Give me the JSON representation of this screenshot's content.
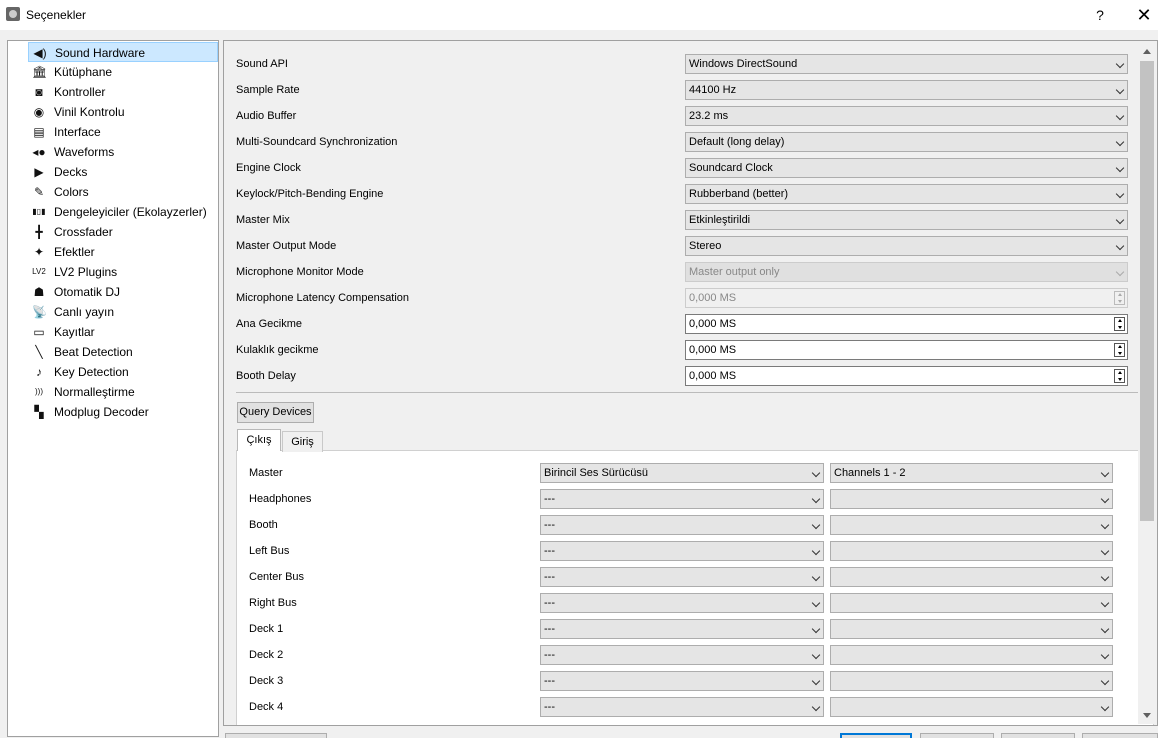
{
  "window": {
    "title": "Seçenekler",
    "help": "?",
    "close": "✕"
  },
  "sidebar": {
    "items": [
      {
        "label": "Sound Hardware",
        "icon": "speaker-icon",
        "glyph": "◀)",
        "selected": true
      },
      {
        "label": "Kütüphane",
        "icon": "library-icon",
        "glyph": "🏛"
      },
      {
        "label": "Kontroller",
        "icon": "controller-icon",
        "glyph": "◙"
      },
      {
        "label": "Vinil Kontrolu",
        "icon": "vinyl-icon",
        "glyph": "◉"
      },
      {
        "label": "Interface",
        "icon": "interface-icon",
        "glyph": "▤"
      },
      {
        "label": "Waveforms",
        "icon": "waveforms-icon",
        "glyph": "◂●"
      },
      {
        "label": "Decks",
        "icon": "play-icon",
        "glyph": "▶"
      },
      {
        "label": "Colors",
        "icon": "paint-icon",
        "glyph": "✎"
      },
      {
        "label": "Dengeleyiciler (Ekolayzerler)",
        "icon": "equalizer-icon",
        "glyph": "▮▯▮"
      },
      {
        "label": "Crossfader",
        "icon": "crossfader-icon",
        "glyph": "╋"
      },
      {
        "label": "Efektler",
        "icon": "effects-icon",
        "glyph": "✦"
      },
      {
        "label": "LV2 Plugins",
        "icon": "lv2-icon",
        "glyph": "LV2"
      },
      {
        "label": "Otomatik DJ",
        "icon": "robot-icon",
        "glyph": "☗"
      },
      {
        "label": "Canlı yayın",
        "icon": "broadcast-icon",
        "glyph": "📡"
      },
      {
        "label": "Kayıtlar",
        "icon": "recording-icon",
        "glyph": "▭"
      },
      {
        "label": "Beat Detection",
        "icon": "beat-icon",
        "glyph": "╲"
      },
      {
        "label": "Key Detection",
        "icon": "key-icon",
        "glyph": "♪"
      },
      {
        "label": "Normalleştirme",
        "icon": "normalize-icon",
        "glyph": ")))"
      },
      {
        "label": "Modplug Decoder",
        "icon": "modplug-icon",
        "glyph": "▚"
      }
    ]
  },
  "settings": [
    {
      "label": "Sound API",
      "value": "Windows DirectSound",
      "kind": "combo"
    },
    {
      "label": "Sample Rate",
      "value": "44100 Hz",
      "kind": "combo"
    },
    {
      "label": "Audio Buffer",
      "value": "23.2 ms",
      "kind": "combo"
    },
    {
      "label": "Multi-Soundcard Synchronization",
      "value": "Default (long delay)",
      "kind": "combo"
    },
    {
      "label": "Engine Clock",
      "value": "Soundcard Clock",
      "kind": "combo"
    },
    {
      "label": "Keylock/Pitch-Bending Engine",
      "value": "Rubberband (better)",
      "kind": "combo"
    },
    {
      "label": "Master Mix",
      "value": "Etkinleştirildi",
      "kind": "combo"
    },
    {
      "label": "Master Output Mode",
      "value": "Stereo",
      "kind": "combo"
    },
    {
      "label": "Microphone Monitor Mode",
      "value": "Master output only",
      "kind": "combo",
      "disabled": true
    },
    {
      "label": "Microphone Latency Compensation",
      "value": "0,000 MS",
      "kind": "spin",
      "disabled": true
    },
    {
      "label": "Ana Gecikme",
      "value": "0,000 MS",
      "kind": "spin"
    },
    {
      "label": "Kulaklık gecikme",
      "value": "0,000 MS",
      "kind": "spin"
    },
    {
      "label": "Booth Delay",
      "value": "0,000 MS",
      "kind": "spin"
    }
  ],
  "query_button": "Query Devices",
  "tabs": [
    {
      "label": "Çıkış",
      "active": true
    },
    {
      "label": "Giriş",
      "active": false
    }
  ],
  "outputs": [
    {
      "label": "Master",
      "device": "Birincil Ses Sürücüsü",
      "channels": "Channels 1 - 2"
    },
    {
      "label": "Headphones",
      "device": "---",
      "channels": ""
    },
    {
      "label": "Booth",
      "device": "---",
      "channels": ""
    },
    {
      "label": "Left Bus",
      "device": "---",
      "channels": ""
    },
    {
      "label": "Center Bus",
      "device": "---",
      "channels": ""
    },
    {
      "label": "Right Bus",
      "device": "---",
      "channels": ""
    },
    {
      "label": "Deck 1",
      "device": "---",
      "channels": ""
    },
    {
      "label": "Deck 2",
      "device": "---",
      "channels": ""
    },
    {
      "label": "Deck 3",
      "device": "---",
      "channels": ""
    },
    {
      "label": "Deck 4",
      "device": "---",
      "channels": ""
    }
  ],
  "colors": {
    "selection": "#cce8ff",
    "focus": "#0078d7"
  }
}
